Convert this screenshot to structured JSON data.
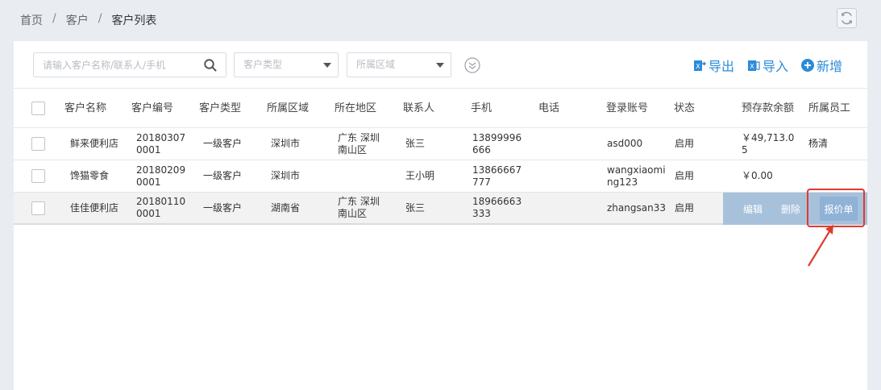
{
  "breadcrumb": {
    "home": "首页",
    "level2": "客户",
    "current": "客户列表",
    "separator": "/"
  },
  "toolbar": {
    "search_placeholder": "请输入客户名称/联系人/手机",
    "type_select_placeholder": "客户类型",
    "region_select_placeholder": "所属区域",
    "export_label": "导出",
    "import_label": "导入",
    "new_label": "新增"
  },
  "table": {
    "columns": [
      "客户名称",
      "客户编号",
      "客户类型",
      "所属区域",
      "所在地区",
      "联系人",
      "手机",
      "电话",
      "登录账号",
      "状态",
      "预存款余额",
      "所属员工"
    ],
    "rows": [
      {
        "name": "鲜来便利店",
        "code": "201803070001",
        "type": "一级客户",
        "region": "深圳市",
        "area": "广东 深圳 南山区",
        "contact": "张三",
        "mobile": "13899996666",
        "phone": "",
        "account": "asd000",
        "status": "启用",
        "balance": "￥49,713.05",
        "staff": "杨清"
      },
      {
        "name": "馋猫零食",
        "code": "201802090001",
        "type": "一级客户",
        "region": "深圳市",
        "area": "",
        "contact": "王小明",
        "mobile": "13866667777",
        "phone": "",
        "account": "wangxiaoming123",
        "status": "启用",
        "balance": "￥0.00",
        "staff": ""
      },
      {
        "name": "佳佳便利店",
        "code": "201801100001",
        "type": "一级客户",
        "region": "湖南省",
        "area": "广东 深圳 南山区",
        "contact": "张三",
        "mobile": "18966663333",
        "phone": "",
        "account": "zhangsan33",
        "status": "启用",
        "balance": "",
        "staff": ""
      }
    ]
  },
  "row_actions": {
    "edit": "编辑",
    "delete": "删除",
    "quote": "报价单"
  },
  "colors": {
    "accent": "#2b8bd9",
    "highlight": "#e03a2e",
    "row_action_bg": "#a8c1db"
  }
}
